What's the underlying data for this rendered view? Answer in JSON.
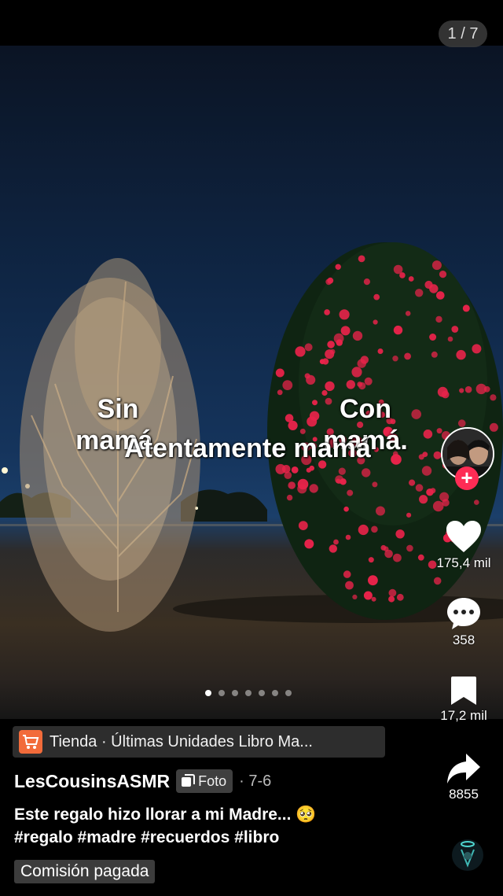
{
  "post": {
    "counter": "1 / 7",
    "overlay_left": "Sin\nmamá.",
    "overlay_right": "Con\nmamá.",
    "overlay_bottom": "Atentamente mamá",
    "dots_total": 7,
    "dot_active": 1
  },
  "actions": {
    "likes": "175,4 mil",
    "comments": "358",
    "saves": "17,2 mil",
    "shares": "8855"
  },
  "shop": {
    "label": "Tienda · Últimas Unidades Libro Ma..."
  },
  "author": {
    "username": "LesCousinsASMR",
    "badge": "Foto",
    "date": "· 7-6"
  },
  "caption": {
    "text": "Este regalo hizo llorar a mi Madre... 🥺",
    "hashtags": "#regalo #madre #recuerdos #libro"
  },
  "label_paid": "Comisión pagada",
  "colors": {
    "follow": "#fe2c55",
    "shop_icon": "#f26b3a",
    "flowers": "#e8234a"
  },
  "icons": [
    "cart-icon",
    "heart-icon",
    "comment-icon",
    "bookmark-icon",
    "share-icon",
    "photo-icon",
    "plus-icon",
    "music-disc-icon"
  ]
}
